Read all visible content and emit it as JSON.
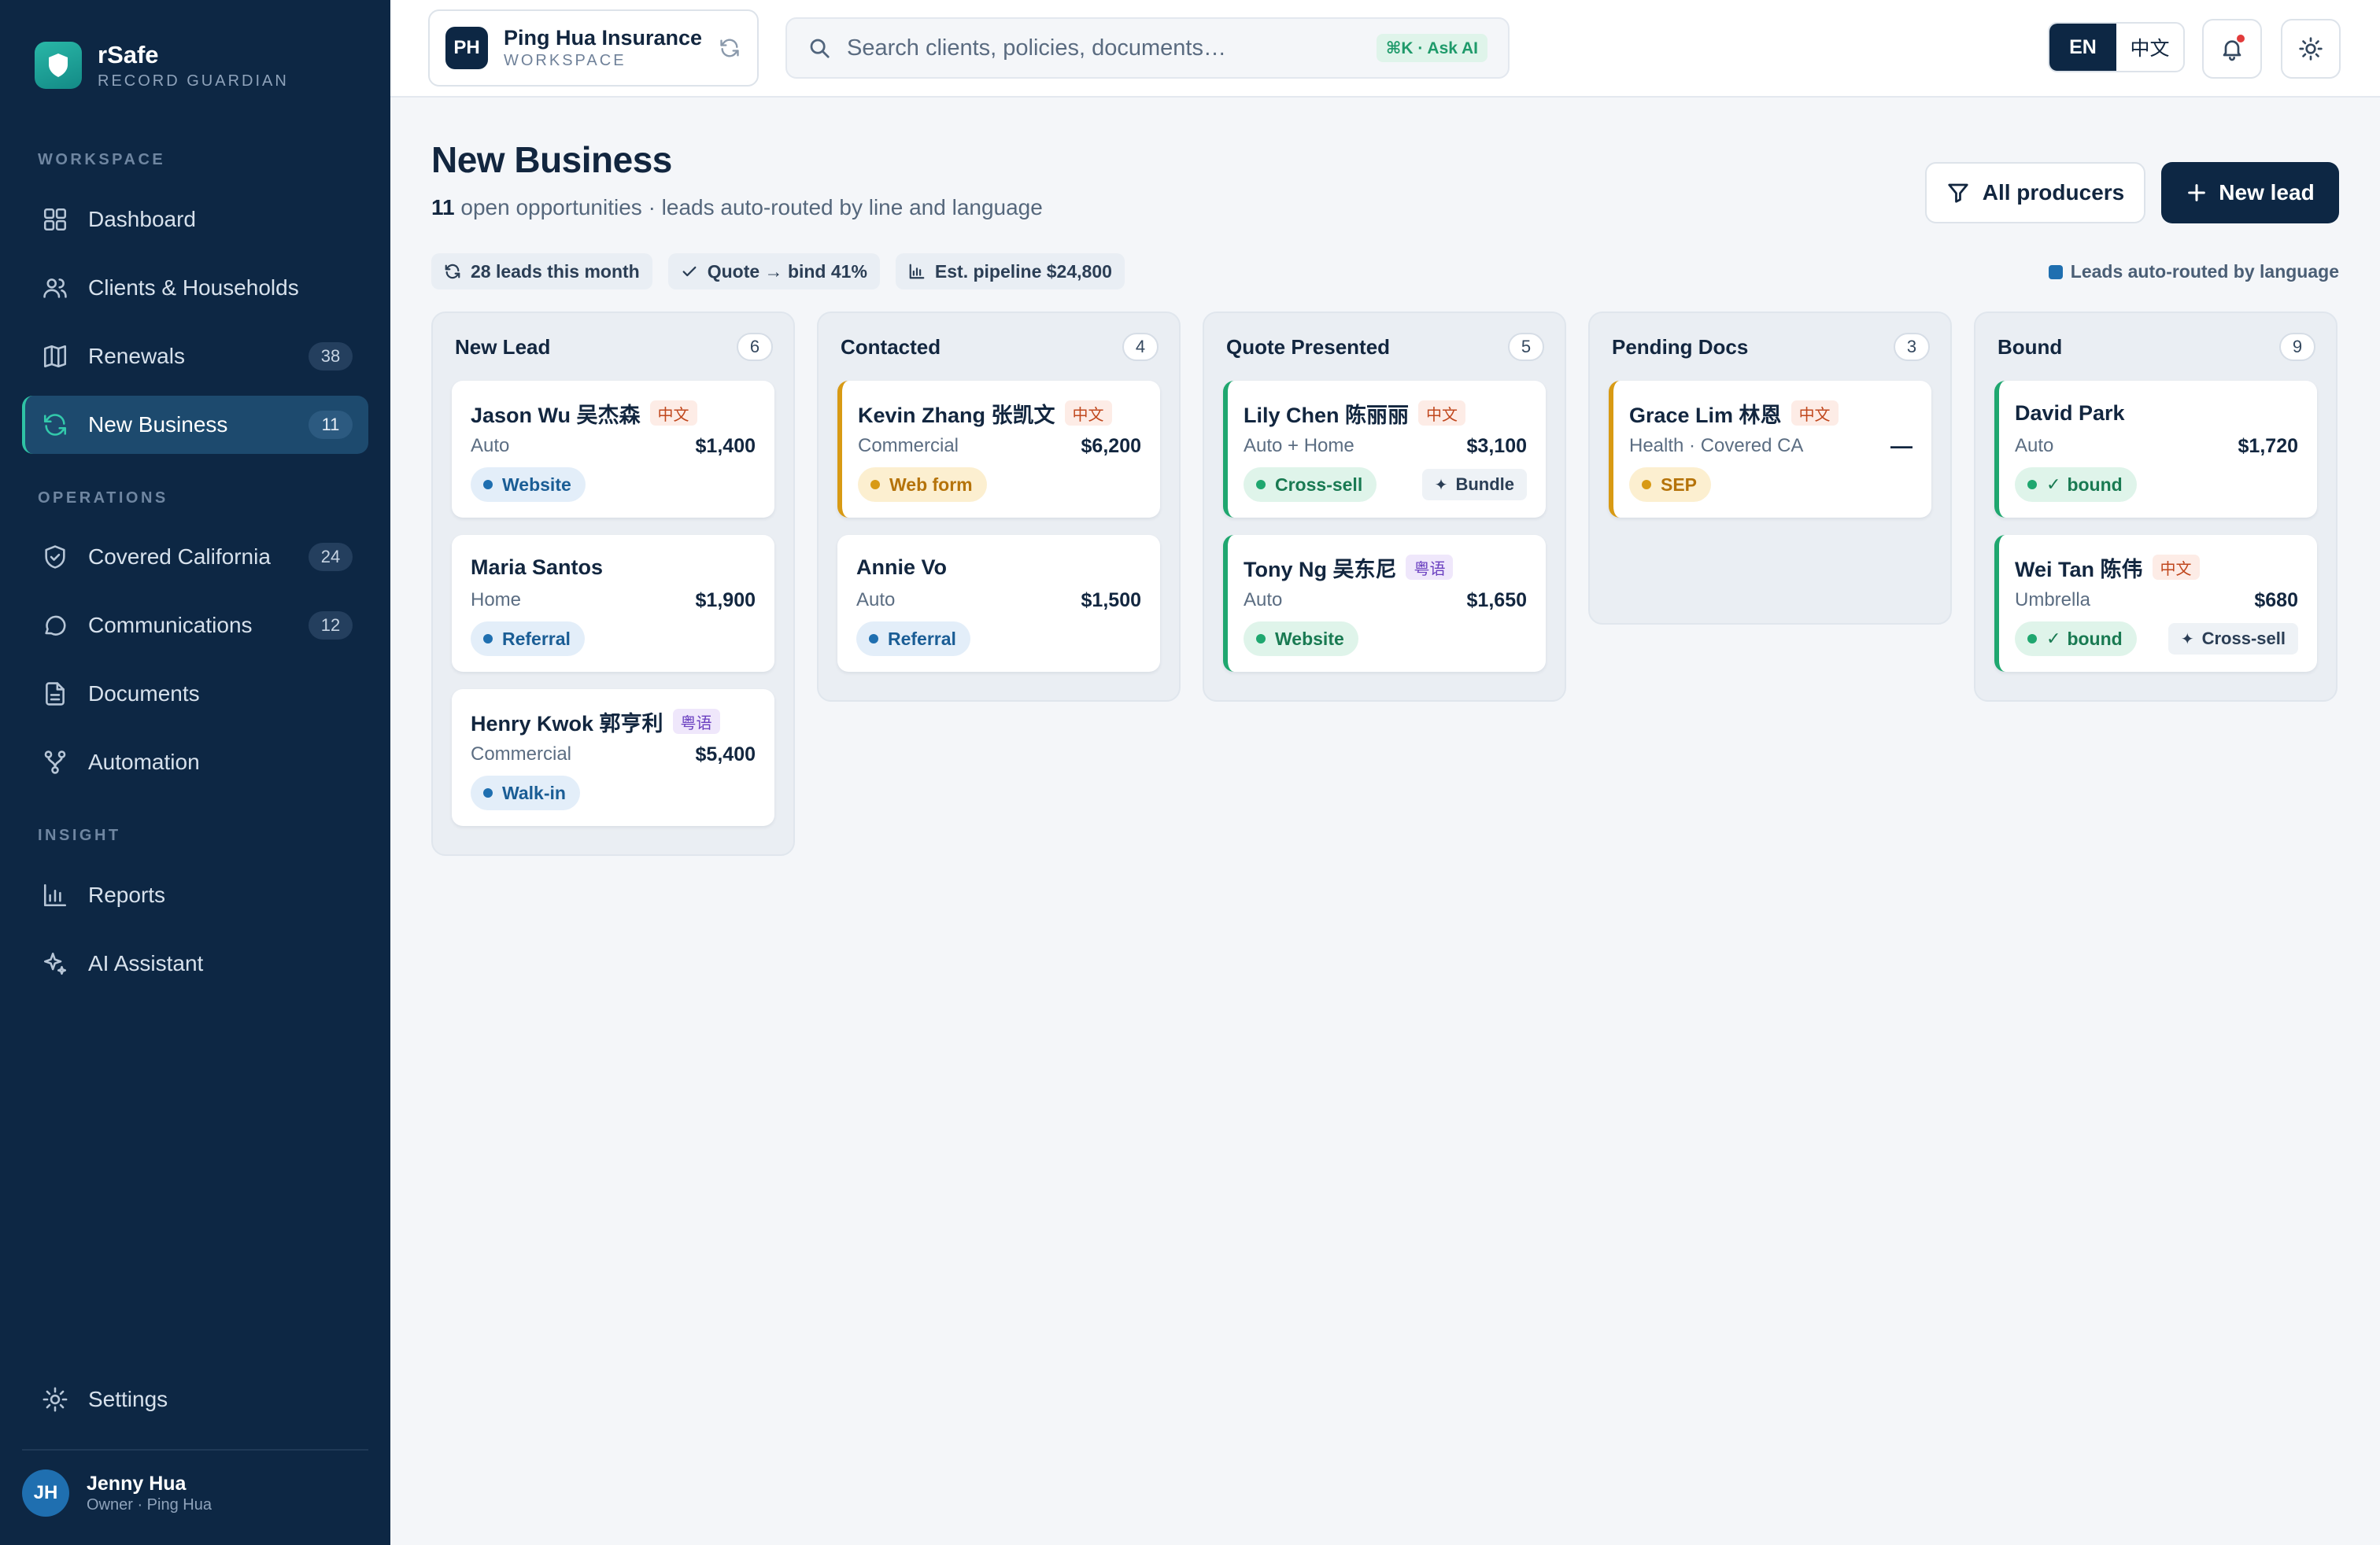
{
  "brand": {
    "name": "rSafe",
    "subtitle": "RECORD GUARDIAN"
  },
  "sidebar": {
    "section_workspace": "WORKSPACE",
    "section_operations": "OPERATIONS",
    "section_insight": "INSIGHT",
    "items": [
      {
        "label": "Dashboard",
        "icon": "grid-icon"
      },
      {
        "label": "Clients & Households",
        "icon": "users-icon"
      },
      {
        "label": "Renewals",
        "icon": "map-icon",
        "count": "38"
      },
      {
        "label": "New Business",
        "icon": "refresh-icon",
        "count": "11",
        "active": true
      },
      {
        "label": "Covered California",
        "icon": "shield-check-icon",
        "count": "24"
      },
      {
        "label": "Communications",
        "icon": "chat-icon",
        "count": "12"
      },
      {
        "label": "Documents",
        "icon": "document-icon"
      },
      {
        "label": "Automation",
        "icon": "workflow-icon"
      },
      {
        "label": "Reports",
        "icon": "bar-chart-icon"
      },
      {
        "label": "AI Assistant",
        "icon": "sparkle-icon"
      },
      {
        "label": "Settings",
        "icon": "gear-icon"
      }
    ],
    "user": {
      "initials": "JH",
      "name": "Jenny Hua",
      "role": "Owner · Ping Hua"
    }
  },
  "topbar": {
    "workspace": {
      "initials": "PH",
      "name": "Ping Hua Insurance",
      "label": "WORKSPACE"
    },
    "search": {
      "placeholder": "Search clients, policies, documents…",
      "hint": "⌘K · Ask AI"
    },
    "lang": {
      "en": "EN",
      "zh": "中文",
      "selected": "EN"
    }
  },
  "page": {
    "title": "New Business",
    "subtitle_count": "11",
    "subtitle_text": "open opportunities · leads auto-routed by line and language",
    "filter_label": "All producers",
    "new_lead_label": "New lead",
    "chips": [
      "28 leads this month",
      "Quote → bind 41%",
      "Est. pipeline $24,800"
    ],
    "legend": "Leads auto-routed by language"
  },
  "board": {
    "columns": [
      {
        "title": "New Lead",
        "count": "6",
        "cards": [
          {
            "name": "Jason Wu 吴杰森",
            "lang": "中文",
            "line": "Auto",
            "amount": "$1,400",
            "source": "Website"
          },
          {
            "name": "Maria Santos",
            "line": "Home",
            "amount": "$1,900",
            "source": "Referral"
          },
          {
            "name": "Henry Kwok 郭亨利",
            "lang": "粤语",
            "line": "Commercial",
            "amount": "$5,400",
            "source": "Walk-in"
          }
        ]
      },
      {
        "title": "Contacted",
        "count": "4",
        "cards": [
          {
            "name": "Kevin Zhang 张凯文",
            "lang": "中文",
            "line": "Commercial",
            "amount": "$6,200",
            "source": "Web form"
          },
          {
            "name": "Annie Vo",
            "line": "Auto",
            "amount": "$1,500",
            "source": "Referral"
          }
        ]
      },
      {
        "title": "Quote Presented",
        "count": "5",
        "cards": [
          {
            "name": "Lily Chen 陈丽丽",
            "lang": "中文",
            "line": "Auto + Home",
            "amount": "$3,100",
            "source": "Cross-sell",
            "extra": "Bundle"
          },
          {
            "name": "Tony Ng 吴东尼",
            "lang": "粤语",
            "line": "Auto",
            "amount": "$1,650",
            "source": "Website"
          }
        ]
      },
      {
        "title": "Pending Docs",
        "count": "3",
        "cards": [
          {
            "name": "Grace Lim 林恩",
            "lang": "中文",
            "line": "Health · Covered CA",
            "amount": "—",
            "source": "SEP"
          }
        ]
      },
      {
        "title": "Bound",
        "count": "9",
        "cards": [
          {
            "name": "David Park",
            "line": "Auto",
            "amount": "$1,720",
            "source": "bound"
          },
          {
            "name": "Wei Tan 陈伟",
            "lang": "中文",
            "line": "Umbrella",
            "amount": "$680",
            "source": "bound",
            "extra": "Cross-sell"
          }
        ]
      }
    ]
  }
}
